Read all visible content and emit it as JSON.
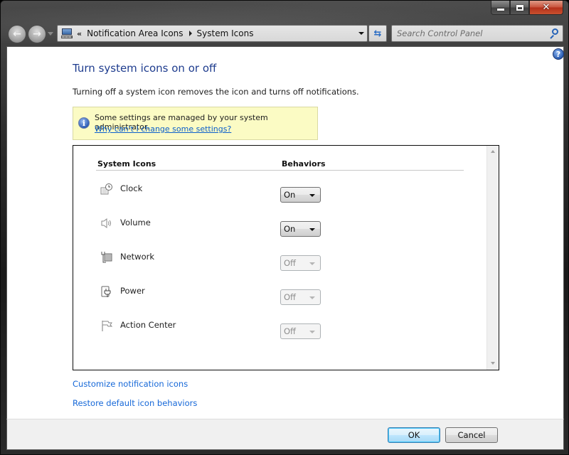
{
  "window": {
    "caption_buttons": {
      "minimize": "minimize",
      "maximize": "maximize",
      "close": "close"
    }
  },
  "nav": {
    "back_icon": "back-arrow-icon",
    "forward_icon": "forward-arrow-icon",
    "recent_icon": "chevron-down-icon"
  },
  "address_bar": {
    "icon": "control-panel-icon",
    "overflow": "«",
    "breadcrumbs": [
      "Notification Area Icons",
      "System Icons"
    ]
  },
  "search": {
    "placeholder": "Search Control Panel",
    "value": ""
  },
  "help": {
    "label": "?"
  },
  "page": {
    "title": "Turn system icons on or off",
    "description": "Turning off a system icon removes the icon and turns off notifications."
  },
  "info_banner": {
    "icon": "i",
    "text": "Some settings are managed by your system administrator.",
    "link": "Why can't I change some settings?"
  },
  "table": {
    "headers": {
      "system_icons": "System Icons",
      "behaviors": "Behaviors"
    },
    "rows": [
      {
        "name": "Clock",
        "icon": "clock-icon",
        "behavior": "On",
        "enabled": true
      },
      {
        "name": "Volume",
        "icon": "volume-icon",
        "behavior": "On",
        "enabled": true
      },
      {
        "name": "Network",
        "icon": "network-icon",
        "behavior": "Off",
        "enabled": false
      },
      {
        "name": "Power",
        "icon": "power-icon",
        "behavior": "Off",
        "enabled": false
      },
      {
        "name": "Action Center",
        "icon": "flag-icon",
        "behavior": "Off",
        "enabled": false
      }
    ]
  },
  "links": {
    "customize": "Customize notification icons",
    "restore": "Restore default icon behaviors"
  },
  "footer": {
    "ok": "OK",
    "cancel": "Cancel"
  },
  "colors": {
    "title": "#1e3c8e",
    "link": "#1668d8",
    "banner_bg": "#fbfbc4",
    "close_button": "#c8513a"
  }
}
